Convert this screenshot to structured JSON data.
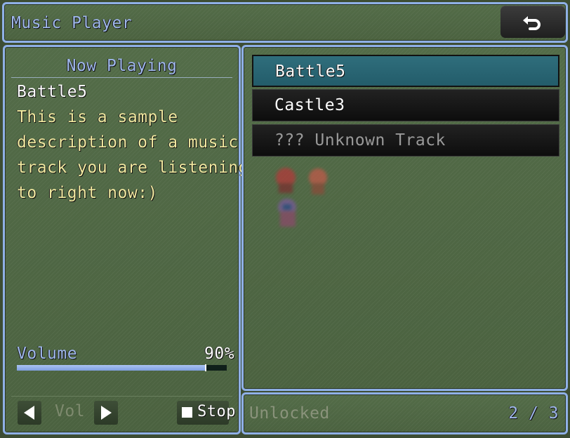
{
  "header": {
    "title": "Music Player",
    "back_icon": "return-arrow-icon"
  },
  "now_playing": {
    "heading": "Now Playing",
    "track_name": "Battle5",
    "description_lines": [
      "This is a sample",
      "description of a music",
      "track you are listening",
      "to right now:)"
    ]
  },
  "volume": {
    "label": "Volume",
    "percent_text": "90%",
    "level": 0.9
  },
  "controls": {
    "prev_icon": "triangle-left-icon",
    "vol_label": "Vol",
    "next_icon": "triangle-right-icon",
    "stop_label": "Stop"
  },
  "tracks": [
    {
      "label": "Battle5",
      "selected": true,
      "unlocked": true
    },
    {
      "label": "Castle3",
      "selected": false,
      "unlocked": true
    },
    {
      "label": "??? Unknown Track",
      "selected": false,
      "unlocked": false
    }
  ],
  "footer": {
    "unlocked_label": "Unlocked",
    "count_text": "2 / 3"
  },
  "colors": {
    "accent_blue": "#9fb8ec",
    "description_yellow": "#f2eaa0",
    "window_green": "#4f6744",
    "selected_teal": "#2a6877",
    "volume_fill": "#8fabe8"
  }
}
